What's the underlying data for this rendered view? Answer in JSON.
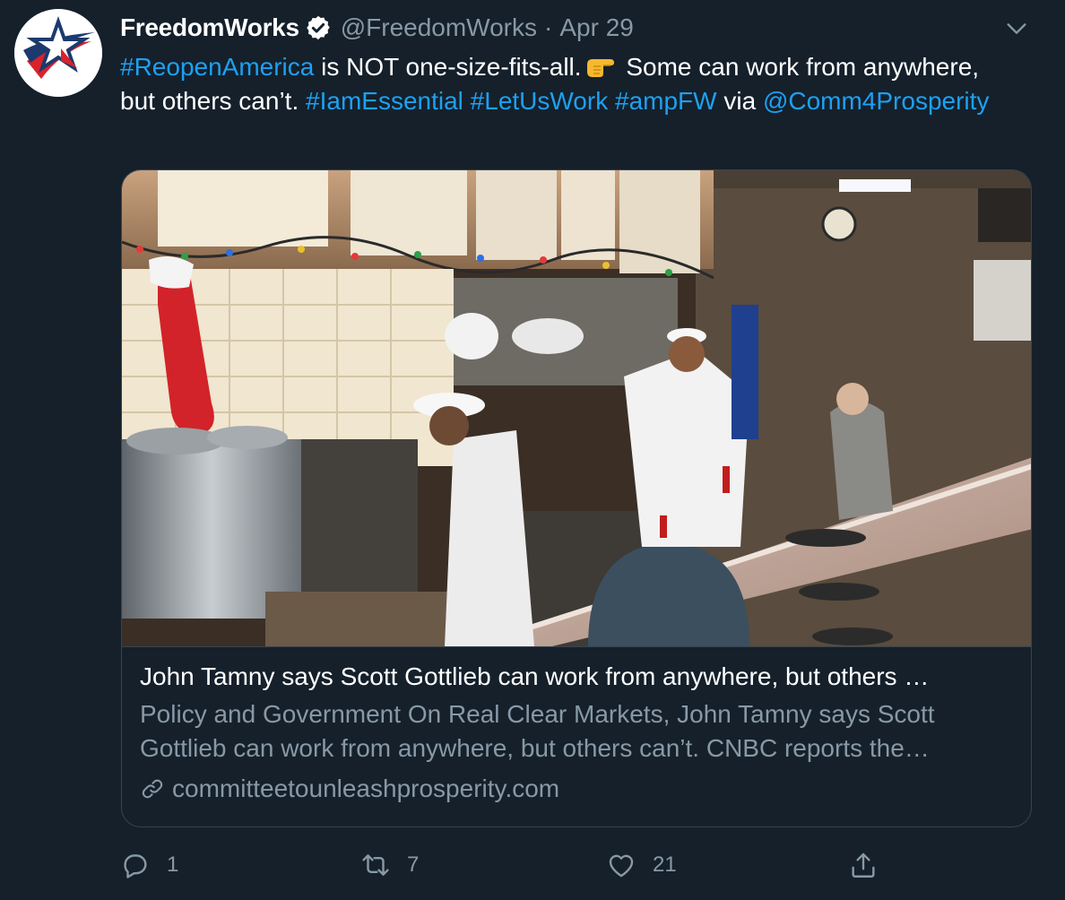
{
  "tweet": {
    "display_name": "FreedomWorks",
    "handle": "@FreedomWorks",
    "separator": "·",
    "date": "Apr 29",
    "text": {
      "hashtag1": "#ReopenAmerica",
      "part1": " is NOT one-size-fits-all.",
      "part2": " Some can work from anywhere, but others can’t. ",
      "hashtag2": "#IamEssential",
      "hashtag3": "#LetUsWork",
      "hashtag4": "#ampFW",
      "part3": " via ",
      "mention": "@Comm4Prosperity"
    }
  },
  "card": {
    "title": "John Tamny says Scott Gottlieb can work from anywhere, but others …",
    "description": "Policy and Government On Real Clear Markets, John Tamny says Scott Gottlieb can work from anywhere, but others can’t. CNBC reports the…",
    "domain": "committeetounleashprosperity.com"
  },
  "actions": {
    "reply_count": "1",
    "retweet_count": "7",
    "like_count": "21"
  },
  "icons": [
    "freedomworks-logo-icon",
    "verified-badge-icon",
    "chevron-down-icon",
    "pointing-hand-emoji-icon",
    "link-icon",
    "reply-icon",
    "retweet-icon",
    "like-icon",
    "share-icon"
  ],
  "colors": {
    "background": "#15202b",
    "link": "#1da1f2",
    "secondary_text": "#8899a6",
    "border": "#38444d"
  }
}
